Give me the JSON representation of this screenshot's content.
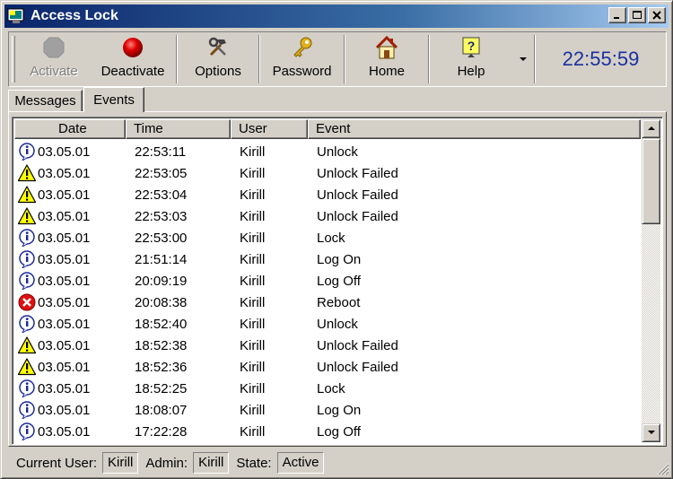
{
  "window": {
    "title": "Access Lock",
    "controls": {
      "minimize": "_",
      "maximize": "□",
      "close": "×"
    }
  },
  "toolbar": {
    "activate_label": "Activate",
    "deactivate_label": "Deactivate",
    "options_label": "Options",
    "password_label": "Password",
    "home_label": "Home",
    "help_label": "Help",
    "clock": "22:55:59"
  },
  "tabs": [
    {
      "label": "Messages"
    },
    {
      "label": "Events"
    }
  ],
  "columns": [
    "Date",
    "Time",
    "User",
    "Event"
  ],
  "events": [
    {
      "icon": "info-icon",
      "date": "03.05.01",
      "time": "22:53:11",
      "user": "Kirill",
      "event": "Unlock"
    },
    {
      "icon": "warning-icon",
      "date": "03.05.01",
      "time": "22:53:05",
      "user": "Kirill",
      "event": "Unlock Failed"
    },
    {
      "icon": "warning-icon",
      "date": "03.05.01",
      "time": "22:53:04",
      "user": "Kirill",
      "event": "Unlock Failed"
    },
    {
      "icon": "warning-icon",
      "date": "03.05.01",
      "time": "22:53:03",
      "user": "Kirill",
      "event": "Unlock Failed"
    },
    {
      "icon": "info-icon",
      "date": "03.05.01",
      "time": "22:53:00",
      "user": "Kirill",
      "event": "Lock"
    },
    {
      "icon": "info-icon",
      "date": "03.05.01",
      "time": "21:51:14",
      "user": "Kirill",
      "event": "Log On"
    },
    {
      "icon": "info-icon",
      "date": "03.05.01",
      "time": "20:09:19",
      "user": "Kirill",
      "event": "Log Off"
    },
    {
      "icon": "error-icon",
      "date": "03.05.01",
      "time": "20:08:38",
      "user": "Kirill",
      "event": "Reboot"
    },
    {
      "icon": "info-icon",
      "date": "03.05.01",
      "time": "18:52:40",
      "user": "Kirill",
      "event": "Unlock"
    },
    {
      "icon": "warning-icon",
      "date": "03.05.01",
      "time": "18:52:38",
      "user": "Kirill",
      "event": "Unlock Failed"
    },
    {
      "icon": "warning-icon",
      "date": "03.05.01",
      "time": "18:52:36",
      "user": "Kirill",
      "event": "Unlock Failed"
    },
    {
      "icon": "info-icon",
      "date": "03.05.01",
      "time": "18:52:25",
      "user": "Kirill",
      "event": "Lock"
    },
    {
      "icon": "info-icon",
      "date": "03.05.01",
      "time": "18:08:07",
      "user": "Kirill",
      "event": "Log On"
    },
    {
      "icon": "info-icon",
      "date": "03.05.01",
      "time": "17:22:28",
      "user": "Kirill",
      "event": "Log Off"
    }
  ],
  "status": {
    "current_user_label": "Current User:",
    "current_user": "Kirill",
    "admin_label": "Admin:",
    "admin": "Kirill",
    "state_label": "State:",
    "state": "Active"
  },
  "colors": {
    "titlebar_start": "#0a246a",
    "titlebar_end": "#a6caf0",
    "clock": "#1b2fa0",
    "face": "#d4d0c8"
  }
}
